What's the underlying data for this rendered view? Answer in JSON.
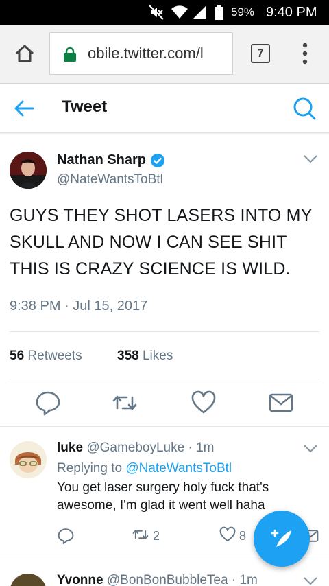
{
  "status_bar": {
    "battery_percent": "59%",
    "time": "9:40 PM",
    "icons": [
      "mute-icon",
      "wifi-icon",
      "signal-icon",
      "battery-icon"
    ]
  },
  "browser": {
    "url": "obile.twitter.com/l",
    "tab_count": "7",
    "icons": [
      "home-icon",
      "lock-icon",
      "menu-dots-icon"
    ]
  },
  "header": {
    "title": "Tweet",
    "icons": [
      "back-arrow-icon",
      "search-icon"
    ]
  },
  "tweet": {
    "name": "Nathan Sharp",
    "handle": "@NateWantsToBtl",
    "verified": true,
    "text": "GUYS THEY SHOT LASERS INTO MY SKULL AND NOW I CAN SEE SHIT THIS IS CRAZY SCIENCE IS WILD.",
    "timestamp": "9:38 PM · Jul 15, 2017",
    "retweets_count": "56",
    "retweets_label": "Retweets",
    "likes_count": "358",
    "likes_label": "Likes",
    "actions": [
      "reply-icon",
      "retweet-icon",
      "like-icon",
      "message-icon"
    ]
  },
  "replies": [
    {
      "name": "luke",
      "handle": "@GameboyLuke",
      "time": "· 1m",
      "replying_prefix": "Replying to",
      "replying_to": "@NateWantsToBtl",
      "text": "You get laser surgery holy fuck that's awesome, I'm glad it went well haha",
      "retweets": "2",
      "likes": "8"
    },
    {
      "name": "Yvonne",
      "handle": "@BonBonBubbleTea",
      "time": "· 1m"
    }
  ],
  "colors": {
    "accent": "#1da1f2",
    "secondary_text": "#657786",
    "primary_text": "#14171a"
  }
}
